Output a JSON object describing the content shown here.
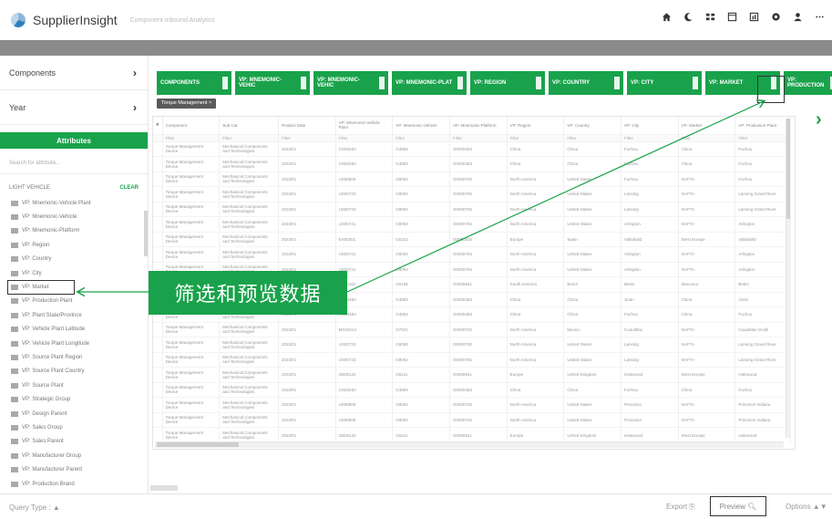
{
  "app": {
    "title": "SupplierInsight",
    "subtitle": "Component Inbound Analytics"
  },
  "header_icons": [
    "home-icon",
    "moon-icon",
    "grid-icon",
    "window-icon",
    "chart-icon",
    "settings-icon",
    "user-icon",
    "more-icon"
  ],
  "left_panel": {
    "components_label": "Components",
    "year_label": "Year",
    "attributes_header": "Attributes",
    "search_placeholder": "Search for attribute...",
    "section_label": "LIGHT VEHICLE",
    "clear_label": "CLEAR",
    "items": [
      "VP: Mnemonic-Vehicle Plant",
      "VP: Mnemonic-Vehicle",
      "VP: Mnemonic-Platform",
      "VP: Region",
      "VP: Country",
      "VP: City",
      "VP: Market",
      "VP: Production Plant",
      "VP: Plant State/Province",
      "VP: Vehicle Plant Latitude",
      "VP: Vehicle Plant Longitude",
      "VP: Source Plant Region",
      "VP: Source Plant Country",
      "VP: Source Plant",
      "VP: Strategic Group",
      "VP: Design Parent",
      "VP: Sales Group",
      "VP: Sales Parent",
      "VP: Manufacturer Group",
      "VP: Manufacturer Parent",
      "VP: Production Brand"
    ],
    "highlighted_item_index": 6
  },
  "field_bar": [
    "COMPONENTS",
    "VP: MNEMONIC-VEHIC",
    "VP: MNEMONIC-VEHIC",
    "VP: MNEMONIC-PLAT",
    "VP: REGION",
    "VP: COUNTRY",
    "VP: CITY",
    "VP: MARKET",
    "VP: PRODUCTION"
  ],
  "filter_chip": "Torque Management ×",
  "table": {
    "columns": [
      "Component",
      "Sub Cat",
      "Product Date",
      "VP: Mnemonic-Vehicle Plant",
      "VP: Mnemonic-Vehicle",
      "VP: Mnemonic-Platform",
      "VP: Region",
      "VP: Country",
      "VP: City",
      "VP: Market",
      "VP: Production Plant"
    ],
    "subheader": [
      "Filter",
      "Filter",
      "Filter",
      "Filter",
      "Filter",
      "Filter",
      "Filter",
      "Filter",
      "Filter",
      "Filter",
      "Filter"
    ],
    "rows": [
      [
        "Torque Management Device",
        "Mechanical Components and Technologies",
        "2023/01",
        "CN00483",
        "G4883",
        "G0000483",
        "China",
        "China",
        "Fuzhou",
        "China",
        "Fuzhou"
      ],
      [
        "Torque Management Device",
        "Mechanical Components and Technologies",
        "2023/01",
        "CN00483",
        "G4883",
        "G0000483",
        "China",
        "China",
        "Fuzhou",
        "China",
        "Fuzhou"
      ],
      [
        "Torque Management Device",
        "Mechanical Components and Technologies",
        "2023/01",
        "US00806",
        "G8092",
        "G0000792",
        "North America",
        "United States",
        "Fuzhou",
        "NAFTA",
        "Fuzhou"
      ],
      [
        "Torque Management Device",
        "Mechanical Components and Technologies",
        "2023/01",
        "US00733",
        "G8092",
        "G0000792",
        "North America",
        "United States",
        "Lansing",
        "NAFTA",
        "Lansing Grand River"
      ],
      [
        "Torque Management Device",
        "Mechanical Components and Technologies",
        "2023/01",
        "US00733",
        "G8092",
        "G0000792",
        "North America",
        "United States",
        "Lansing",
        "NAFTA",
        "Lansing Grand River"
      ],
      [
        "Torque Management Device",
        "Mechanical Components and Technologies",
        "2023/01",
        "US00741",
        "G8093",
        "G0000794",
        "North America",
        "United States",
        "Arlington",
        "NAFTA",
        "Arlington"
      ],
      [
        "Torque Management Device",
        "Mechanical Components and Technologies",
        "2023/01",
        "ES00201",
        "G5312",
        "G0000532",
        "Europe",
        "Spain",
        "Valladolid",
        "West Europe",
        "Valladolid"
      ],
      [
        "Torque Management Device",
        "Mechanical Components and Technologies",
        "2023/01",
        "US00741",
        "G8093",
        "G0000794",
        "North America",
        "United States",
        "Arlington",
        "NAFTA",
        "Arlington"
      ],
      [
        "Torque Management Device",
        "Mechanical Components and Technologies",
        "2023/01",
        "US00741",
        "G8093",
        "G0000794",
        "North America",
        "United States",
        "Arlington",
        "NAFTA",
        "Arlington"
      ],
      [
        "Torque Management Device",
        "Mechanical Components and Technologies",
        "2023/01",
        "BR00182",
        "G6188",
        "G0000641",
        "South America",
        "Brazil",
        "Betim",
        "Mercosur",
        "Betim"
      ],
      [
        "Torque Management Device",
        "Mechanical Components and Technologies",
        "2023/01",
        "CN00483",
        "G4883",
        "G0000483",
        "China",
        "China",
        "Jinan",
        "China",
        "Jinan"
      ],
      [
        "Torque Management Device",
        "Mechanical Components and Technologies",
        "2023/01",
        "CN00483",
        "G4883",
        "G0000483",
        "China",
        "China",
        "Fuzhou",
        "China",
        "Fuzhou"
      ],
      [
        "Torque Management Device",
        "Mechanical Components and Technologies",
        "2023/01",
        "MX00214",
        "G7021",
        "G0000722",
        "North America",
        "Mexico",
        "Cuautitlan",
        "NAFTA",
        "Cuautitlan Izcalli"
      ],
      [
        "Torque Management Device",
        "Mechanical Components and Technologies",
        "2023/01",
        "US00733",
        "G8092",
        "G0000792",
        "North America",
        "United States",
        "Lansing",
        "NAFTA",
        "Lansing Grand River"
      ],
      [
        "Torque Management Device",
        "Mechanical Components and Technologies",
        "2023/01",
        "US00733",
        "G8092",
        "G0000792",
        "North America",
        "United States",
        "Lansing",
        "NAFTA",
        "Lansing Grand River"
      ],
      [
        "Torque Management Device",
        "Mechanical Components and Technologies",
        "2023/01",
        "GB00122",
        "G5411",
        "G0000541",
        "Europe",
        "United Kingdom",
        "Halewood",
        "West Europe",
        "Halewood"
      ],
      [
        "Torque Management Device",
        "Mechanical Components and Technologies",
        "2023/01",
        "CN00483",
        "G4883",
        "G0000483",
        "China",
        "China",
        "Fuzhou",
        "China",
        "Fuzhou"
      ],
      [
        "Torque Management Device",
        "Mechanical Components and Technologies",
        "2023/01",
        "US00806",
        "G8092",
        "G0000792",
        "North America",
        "United States",
        "Princeton",
        "NAFTA",
        "Princeton Indiana"
      ],
      [
        "Torque Management Device",
        "Mechanical Components and Technologies",
        "2023/01",
        "US00806",
        "G8092",
        "G0000792",
        "North America",
        "United States",
        "Princeton",
        "NAFTA",
        "Princeton Indiana"
      ],
      [
        "Torque Management Device",
        "Mechanical Components and Technologies",
        "2023/01",
        "GB00122",
        "G5411",
        "G0000541",
        "Europe",
        "United Kingdom",
        "Halewood",
        "West Europe",
        "Halewood"
      ]
    ]
  },
  "callout": "筛选和预览数据",
  "bottom": {
    "query_type": "Query Type : ▲",
    "export": "Export",
    "preview": "Preview",
    "options": "Options ▲▼"
  },
  "colors": {
    "accent_green": "#19a24b",
    "header_bar": "#8a8a8a"
  }
}
